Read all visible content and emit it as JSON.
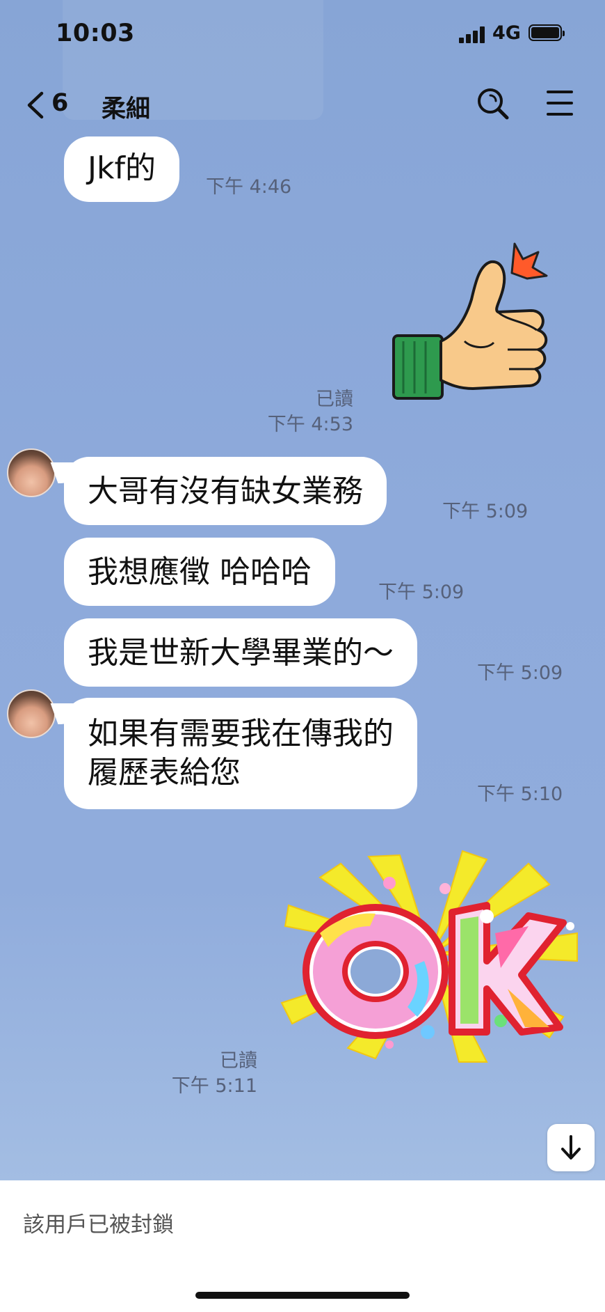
{
  "status_bar": {
    "time": "10:03",
    "network": "4G"
  },
  "nav": {
    "back_count": "6",
    "chat_name": "柔細"
  },
  "messages": [
    {
      "text": "Jkf的",
      "time": "下午 4:46"
    },
    {
      "read": "已讀",
      "time": "下午 4:53",
      "sticker": "thumbs-up"
    },
    {
      "text": "大哥有沒有缺女業務",
      "time": "下午 5:09"
    },
    {
      "text": "我想應徵 哈哈哈",
      "time": "下午 5:09"
    },
    {
      "text": "我是世新大學畢業的～",
      "time": "下午 5:09"
    },
    {
      "line1": "如果有需要我在傳我的",
      "line2": "履歷表給您",
      "time": "下午 5:10"
    },
    {
      "read": "已讀",
      "time": "下午 5:11",
      "sticker": "ok",
      "sticker_text": "OK"
    }
  ],
  "bottom": {
    "status_text": "該用戶已被封鎖"
  },
  "icons": [
    "back-icon",
    "search-icon",
    "menu-icon",
    "arrow-down-icon"
  ],
  "colors": {
    "chat_background": "#8ca9d7",
    "bubble": "#ffffff",
    "timestamp": "#56617a"
  }
}
